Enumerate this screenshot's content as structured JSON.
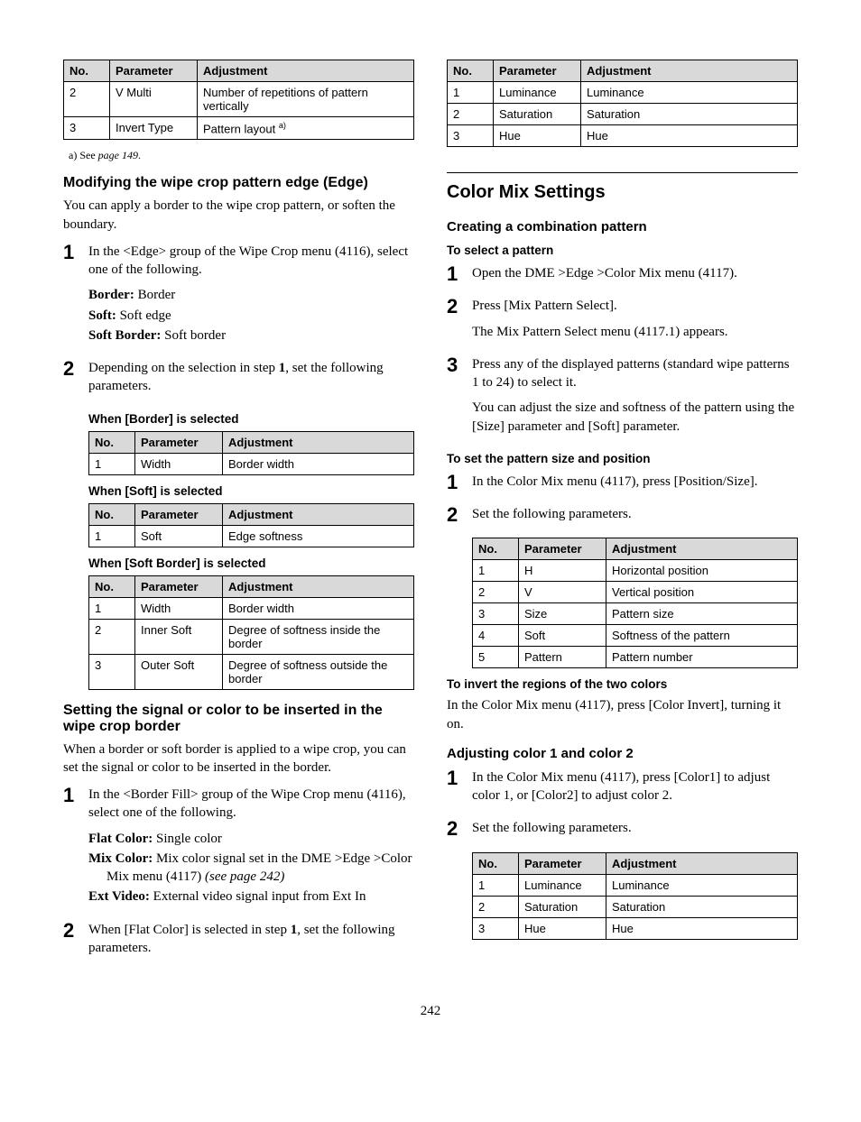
{
  "tableHeaders": {
    "no": "No.",
    "param": "Parameter",
    "adj": "Adjustment"
  },
  "left": {
    "topTable": {
      "rows": [
        {
          "no": "2",
          "param": "V Multi",
          "adj": "Number of repetitions of pattern vertically"
        },
        {
          "no": "3",
          "param": "Invert Type",
          "adj_html": "Pattern layout <sup>a)</sup>"
        }
      ]
    },
    "footnote": {
      "prefix": "a) See ",
      "ref": "page 149",
      "suffix": "."
    },
    "edge": {
      "title": "Modifying the wipe crop pattern edge (Edge)",
      "intro": "You can apply a border to the wipe crop pattern, or soften the boundary.",
      "step1": "In the <Edge> group of the Wipe Crop menu (4116), select one of the following.",
      "defs": [
        {
          "label": "Border:",
          "text": " Border"
        },
        {
          "label": "Soft:",
          "text": " Soft edge"
        },
        {
          "label": "Soft Border:",
          "text": " Soft border"
        }
      ],
      "step2_html": "Depending on the selection in step <b>1</b>, set the following parameters.",
      "whenBorder": "When [Border] is selected",
      "tblBorder": [
        {
          "no": "1",
          "param": "Width",
          "adj": "Border width"
        }
      ],
      "whenSoft": "When [Soft] is selected",
      "tblSoft": [
        {
          "no": "1",
          "param": "Soft",
          "adj": "Edge softness"
        }
      ],
      "whenSoftBorder": "When [Soft Border] is selected",
      "tblSoftBorder": [
        {
          "no": "1",
          "param": "Width",
          "adj": "Border width"
        },
        {
          "no": "2",
          "param": "Inner Soft",
          "adj": "Degree of softness inside the border"
        },
        {
          "no": "3",
          "param": "Outer Soft",
          "adj": "Degree of softness outside the border"
        }
      ]
    },
    "fill": {
      "title": "Setting the signal or color to be inserted in the wipe crop border",
      "intro": "When a border or soft border is applied to a wipe crop, you can set the signal or color to be inserted in the border.",
      "step1": "In the <Border Fill> group of the Wipe Crop menu (4116), select one of the following.",
      "defs": [
        {
          "label": "Flat Color:",
          "text": " Single color"
        },
        {
          "label": "Mix Color:",
          "text_html": " Mix color signal set in the DME >Edge >Color Mix menu (4117) <i>(see page 242)</i>"
        },
        {
          "label": "Ext Video:",
          "text": " External video signal input from Ext In"
        }
      ],
      "step2_html": "When [Flat Color] is selected in step <b>1</b>, set the following parameters."
    }
  },
  "right": {
    "tblFlat": [
      {
        "no": "1",
        "param": "Luminance",
        "adj": "Luminance"
      },
      {
        "no": "2",
        "param": "Saturation",
        "adj": "Saturation"
      },
      {
        "no": "3",
        "param": "Hue",
        "adj": "Hue"
      }
    ],
    "colorMix": {
      "title": "Color Mix Settings",
      "combTitle": "Creating a combination pattern",
      "selectTitle": "To select a pattern",
      "step1": "Open the DME >Edge >Color Mix menu (4117).",
      "step2a": "Press [Mix Pattern Select].",
      "step2b": "The Mix Pattern Select menu (4117.1) appears.",
      "step3a": "Press any of the displayed patterns (standard wipe patterns 1 to 24) to select it.",
      "step3b": "You can adjust the size and softness of the pattern using the [Size] parameter and [Soft] parameter.",
      "sizeTitle": "To set the pattern size and position",
      "sizeStep1": "In the Color Mix menu (4117), press [Position/Size].",
      "sizeStep2": "Set the following parameters.",
      "tblSize": [
        {
          "no": "1",
          "param": "H",
          "adj": "Horizontal position"
        },
        {
          "no": "2",
          "param": "V",
          "adj": "Vertical position"
        },
        {
          "no": "3",
          "param": "Size",
          "adj": "Pattern size"
        },
        {
          "no": "4",
          "param": "Soft",
          "adj": "Softness of the pattern"
        },
        {
          "no": "5",
          "param": "Pattern",
          "adj": "Pattern number"
        }
      ],
      "invertTitle": "To invert the regions of the two colors",
      "invertText": "In the Color Mix menu (4117), press [Color Invert], turning it on.",
      "adjTitle": "Adjusting color 1 and color 2",
      "adjStep1": "In the Color Mix menu (4117), press [Color1] to adjust color 1, or [Color2] to adjust color 2.",
      "adjStep2": "Set the following parameters.",
      "tblAdj": [
        {
          "no": "1",
          "param": "Luminance",
          "adj": "Luminance"
        },
        {
          "no": "2",
          "param": "Saturation",
          "adj": "Saturation"
        },
        {
          "no": "3",
          "param": "Hue",
          "adj": "Hue"
        }
      ]
    }
  },
  "pageNumber": "242"
}
